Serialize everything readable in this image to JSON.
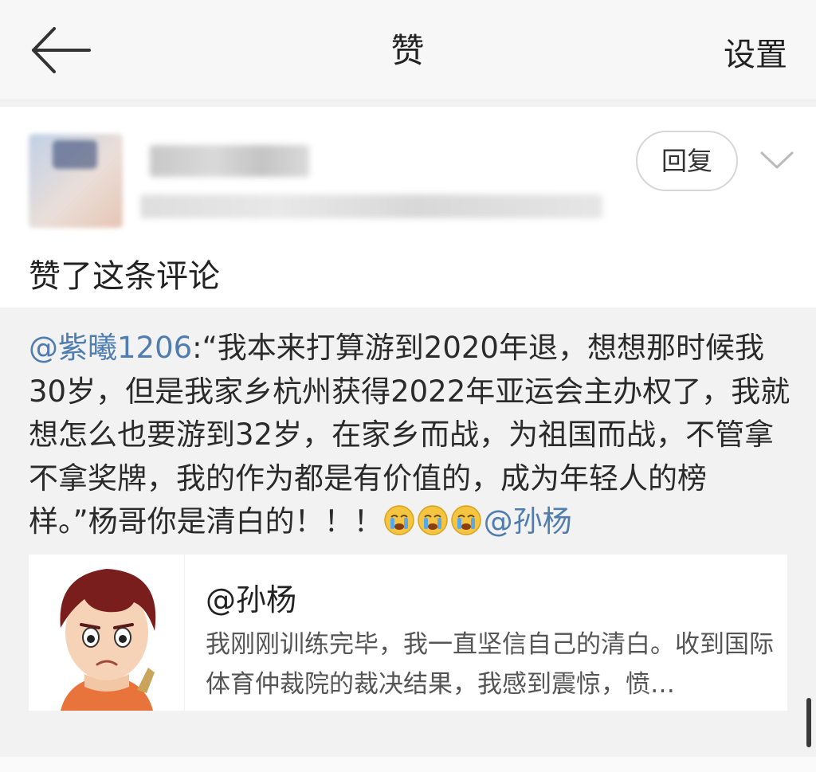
{
  "header": {
    "title": "赞",
    "settings_label": "设置",
    "back_icon": "arrow-left-icon"
  },
  "notification": {
    "reply_label": "回复",
    "more_icon": "chevron-down-icon",
    "action_text": "赞了这条评论"
  },
  "comment": {
    "author_mention": "@紫曦1206",
    "separator": ":",
    "body": "“我本来打算游到2020年退，想想那时候我30岁，但是我家乡杭州获得2022年亚运会主办权了，我就想怎么也要游到32岁，在家乡而战，为祖国而战，不管拿不拿奖牌，我的作为都是有价值的，成为年轻人的榜样。”杨哥你是清白的！！！",
    "emoji_count": 3,
    "emoji_name": "crying-face-icon",
    "tail_mention": "@孙杨"
  },
  "shared_post": {
    "title": "@孙杨",
    "description": "我刚刚训练完毕，我一直坚信自己的清白。收到国际体育仲裁院的裁决结果，我感到震惊，愤…",
    "thumbnail": "cartoon-avatar-icon"
  },
  "colors": {
    "link": "#507daf",
    "background": "#f2f2f2",
    "card": "#ffffff"
  }
}
